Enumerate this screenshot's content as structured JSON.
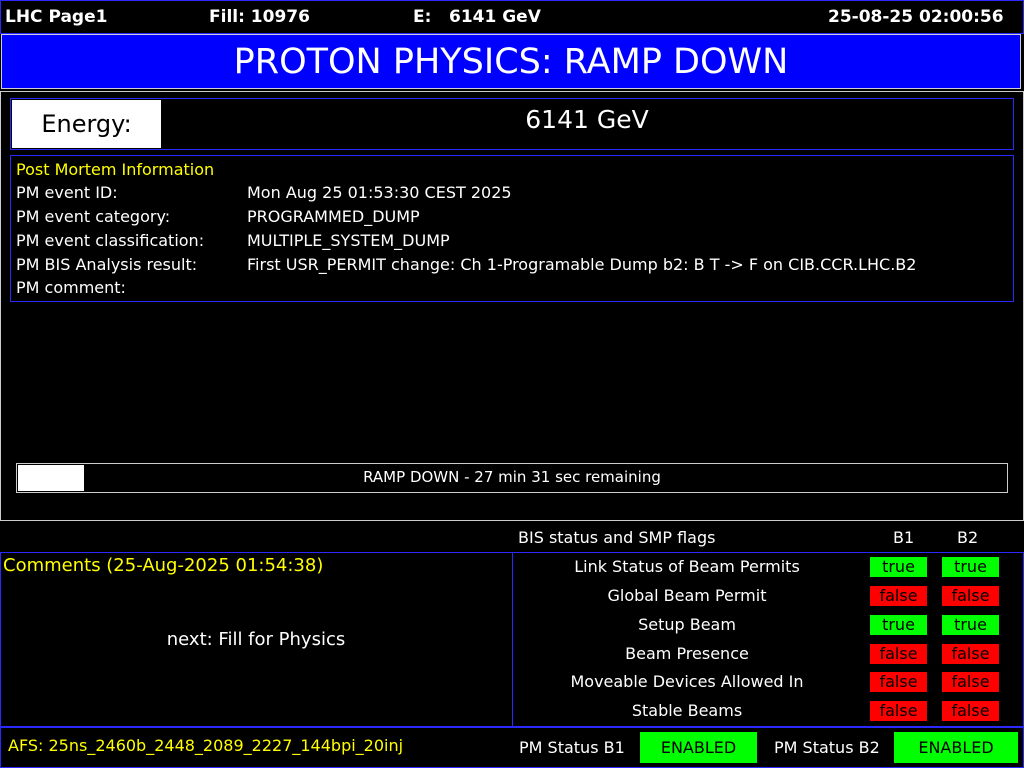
{
  "header": {
    "page": "LHC Page1",
    "fill": "Fill: 10976",
    "energy_label": "E:",
    "energy_value": "6141 GeV",
    "datetime": "25-08-25 02:00:56"
  },
  "title": "PROTON PHYSICS: RAMP DOWN",
  "energy": {
    "label": "Energy:",
    "value": "6141 GeV"
  },
  "post_mortem": {
    "heading": "Post Mortem Information",
    "rows": [
      {
        "label": "PM event ID:",
        "value": "Mon Aug 25 01:53:30 CEST 2025"
      },
      {
        "label": "PM event category:",
        "value": "PROGRAMMED_DUMP"
      },
      {
        "label": "PM event classification:",
        "value": "MULTIPLE_SYSTEM_DUMP"
      },
      {
        "label": "PM BIS Analysis result:",
        "value": "First USR_PERMIT change: Ch 1-Programable Dump b2: B T -> F on CIB.CCR.LHC.B2"
      },
      {
        "label": "PM comment:",
        "value": ""
      }
    ]
  },
  "progress": {
    "text": "RAMP DOWN - 27 min 31 sec remaining",
    "fraction": 0.067
  },
  "bis": {
    "heading": "BIS status and SMP flags",
    "col_b1": "B1",
    "col_b2": "B2",
    "flags": [
      {
        "label": "Link Status of Beam Permits",
        "b1": "true",
        "b2": "true"
      },
      {
        "label": "Global Beam Permit",
        "b1": "false",
        "b2": "false"
      },
      {
        "label": "Setup Beam",
        "b1": "true",
        "b2": "true"
      },
      {
        "label": "Beam Presence",
        "b1": "false",
        "b2": "false"
      },
      {
        "label": "Moveable Devices Allowed In",
        "b1": "false",
        "b2": "false"
      },
      {
        "label": "Stable Beams",
        "b1": "false",
        "b2": "false"
      }
    ]
  },
  "comments": {
    "heading": "Comments (25-Aug-2025 01:54:38)",
    "text": "next: Fill for Physics"
  },
  "footer": {
    "afs": "AFS: 25ns_2460b_2448_2089_2227_144bpi_20inj",
    "pm_b1_label": "PM Status B1",
    "pm_b1_value": "ENABLED",
    "pm_b2_label": "PM Status B2",
    "pm_b2_value": "ENABLED"
  },
  "colors": {
    "title_bg": "#0000ff",
    "true_bg": "#00ff00",
    "false_bg": "#ff0000",
    "heading_text": "#ffff00",
    "border": "#2a2aff"
  }
}
